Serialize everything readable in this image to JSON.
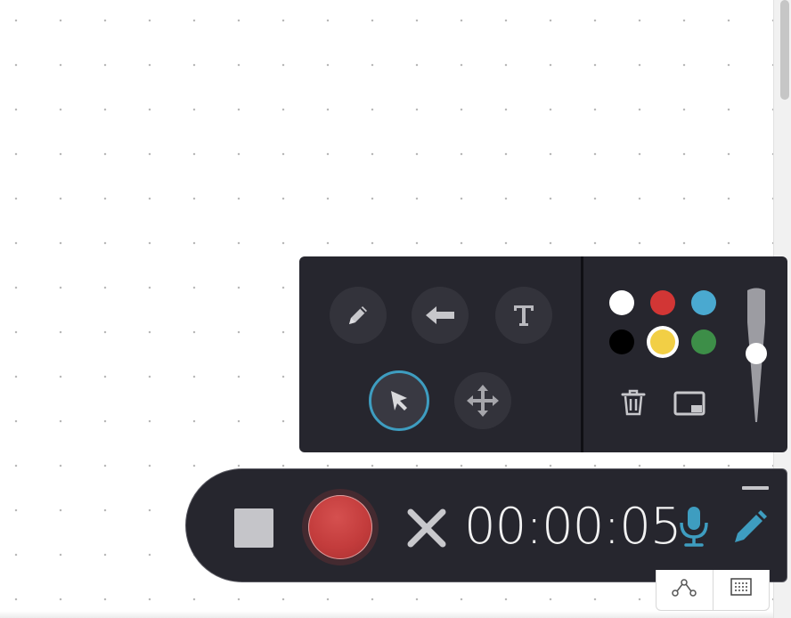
{
  "canvas": {
    "background": "#ffffff",
    "dot_color": "#b9b9b9"
  },
  "palette": {
    "tools": [
      {
        "name": "pencil-tool",
        "icon": "pencil-icon",
        "selected": false
      },
      {
        "name": "arrow-tool",
        "icon": "arrow-left-icon",
        "selected": false
      },
      {
        "name": "text-tool",
        "icon": "text-icon",
        "selected": false
      },
      {
        "name": "select-tool",
        "icon": "cursor-icon",
        "selected": true
      },
      {
        "name": "move-tool",
        "icon": "move-icon",
        "selected": false
      }
    ],
    "colors": [
      {
        "name": "white",
        "hex": "#ffffff",
        "selected": false
      },
      {
        "name": "red",
        "hex": "#d23635",
        "selected": false
      },
      {
        "name": "blue",
        "hex": "#4aa9d0",
        "selected": false
      },
      {
        "name": "black",
        "hex": "#000000",
        "selected": false
      },
      {
        "name": "yellow",
        "hex": "#f2cf45",
        "selected": true
      },
      {
        "name": "green",
        "hex": "#3d8e48",
        "selected": false
      }
    ],
    "actions": [
      {
        "name": "delete",
        "icon": "trash-icon"
      },
      {
        "name": "screen",
        "icon": "screen-icon"
      }
    ],
    "stroke_size_level": 0.55
  },
  "recorder": {
    "timer": "00:00:05",
    "accent": "#3e9dc0",
    "record_color": "#c33c3c",
    "buttons": [
      "stop-icon",
      "record-icon",
      "close-icon",
      "microphone-icon",
      "pencil-icon",
      "minimize-icon"
    ]
  },
  "bottom_toolbar": {
    "buttons": [
      "network-icon",
      "grid-icon"
    ]
  }
}
